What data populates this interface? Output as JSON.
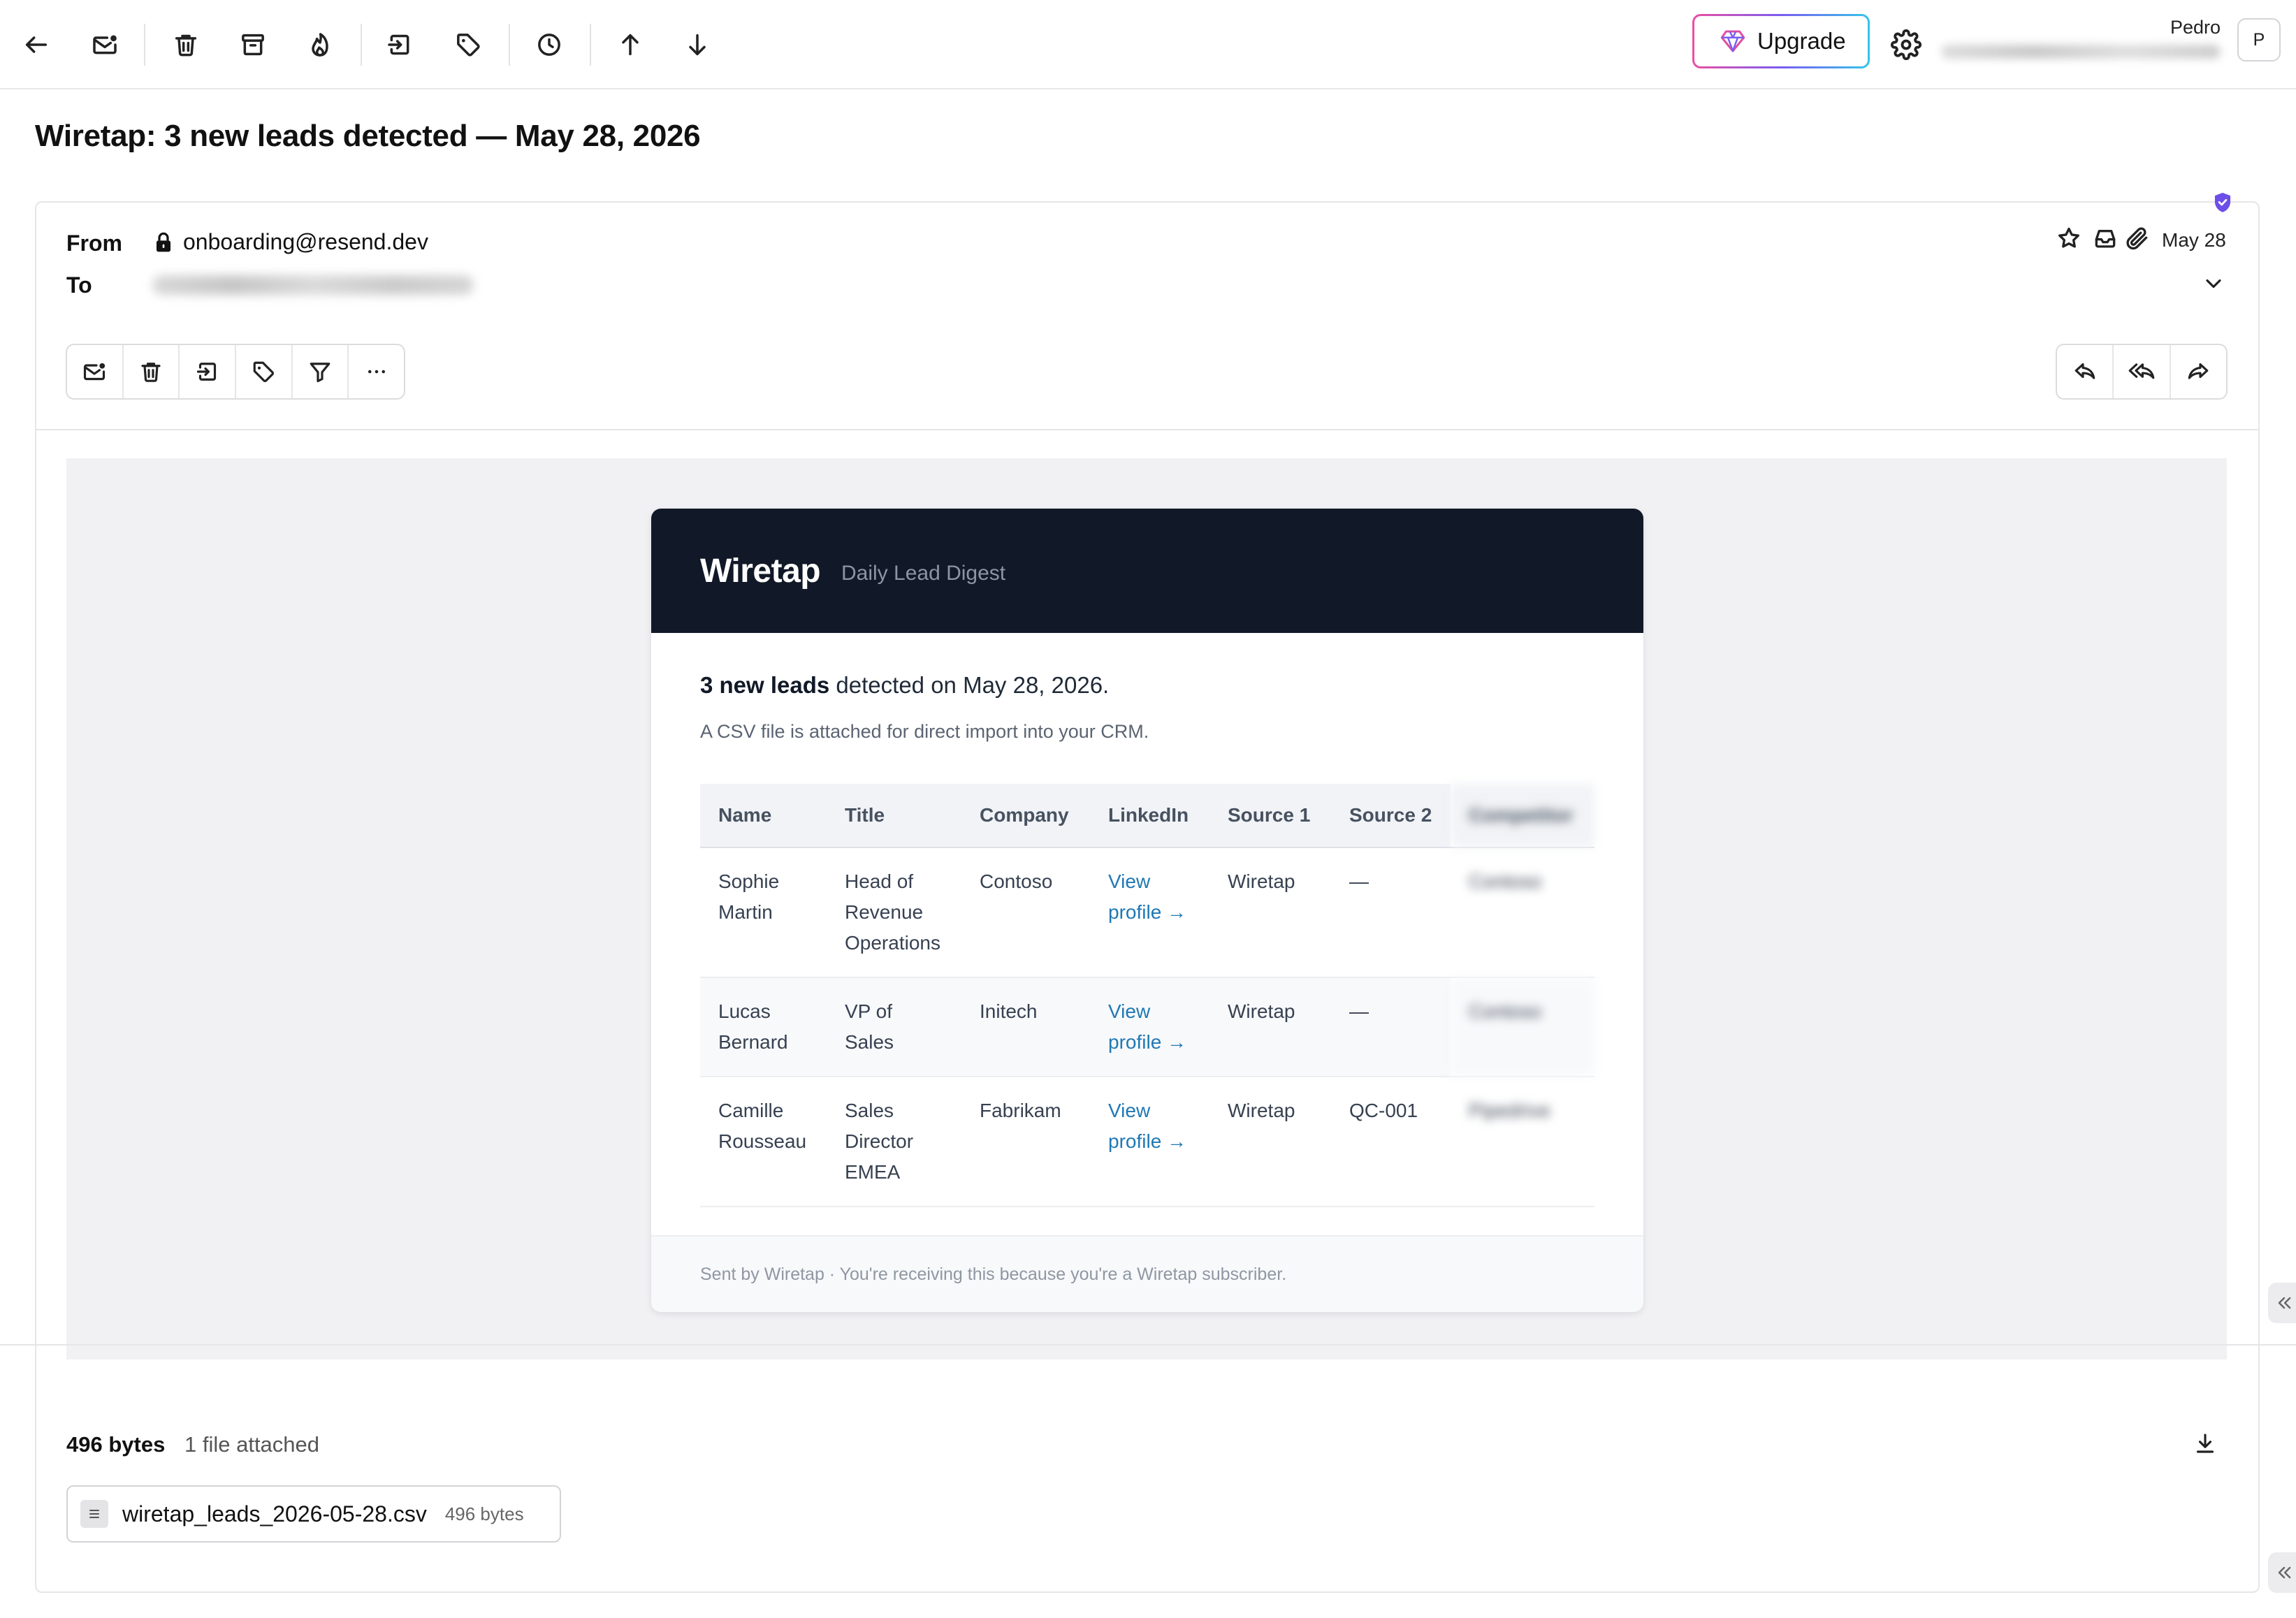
{
  "toolbar": {
    "upgrade_label": "Upgrade",
    "user_name": "Pedro",
    "avatar_initial": "P"
  },
  "message": {
    "subject": "Wiretap: 3 new leads detected — May 28, 2026",
    "from_label": "From",
    "from_address": "onboarding@resend.dev",
    "to_label": "To",
    "date": "May 28"
  },
  "email": {
    "brand": "Wiretap",
    "tagline": "Daily Lead Digest",
    "headline_bold": "3 new leads",
    "headline_rest": " detected on May 28, 2026.",
    "csv_note": "A CSV file is attached for direct import into your CRM.",
    "table": {
      "headers": [
        "Name",
        "Title",
        "Company",
        "LinkedIn",
        "Source 1",
        "Source 2",
        "Competitor"
      ],
      "rows": [
        {
          "name": [
            "Sophie",
            "Martin"
          ],
          "title": [
            "Head of",
            "Revenue",
            "Operations"
          ],
          "company": "Contoso",
          "linkedin": [
            "View",
            "profile →"
          ],
          "source1": "Wiretap",
          "source2": "—",
          "competitor": "Contoso"
        },
        {
          "name": [
            "Lucas",
            "Bernard"
          ],
          "title": [
            "VP of",
            "Sales"
          ],
          "company": "Initech",
          "linkedin": [
            "View",
            "profile →"
          ],
          "source1": "Wiretap",
          "source2": "—",
          "competitor": "Contoso"
        },
        {
          "name": [
            "Camille",
            "Rousseau"
          ],
          "title": [
            "Sales",
            "Director",
            "EMEA"
          ],
          "company": "Fabrikam",
          "linkedin": [
            "View",
            "profile →"
          ],
          "source1": "Wiretap",
          "source2": "QC-001",
          "competitor": "Pipedrive"
        }
      ]
    },
    "footer": "Sent by Wiretap · You're receiving this because you're a Wiretap subscriber."
  },
  "attachments": {
    "total_size": "496 bytes",
    "count_label": "1 file attached",
    "files": [
      {
        "name": "wiretap_leads_2026-05-28.csv",
        "size": "496 bytes"
      }
    ]
  },
  "icons": [
    "back-arrow-icon",
    "mark-unread-icon",
    "trash-icon",
    "archive-icon",
    "flame-icon",
    "move-to-icon",
    "tag-icon",
    "clock-icon",
    "arrow-up-icon",
    "arrow-down-icon",
    "gem-icon",
    "gear-icon",
    "lock-icon",
    "star-icon",
    "inbox-icon",
    "paperclip-icon",
    "chevron-down-icon",
    "filter-icon",
    "more-icon",
    "reply-icon",
    "reply-all-icon",
    "forward-icon",
    "download-icon",
    "file-icon",
    "shield-check-icon",
    "collapse-left-icon"
  ],
  "colors": {
    "banner": "#111827",
    "link": "#1f78b4",
    "shield": "#6d4ee8",
    "upgrade_gradient": [
      "#ec4fa3",
      "#7a5cf0",
      "#32c6ea"
    ]
  }
}
